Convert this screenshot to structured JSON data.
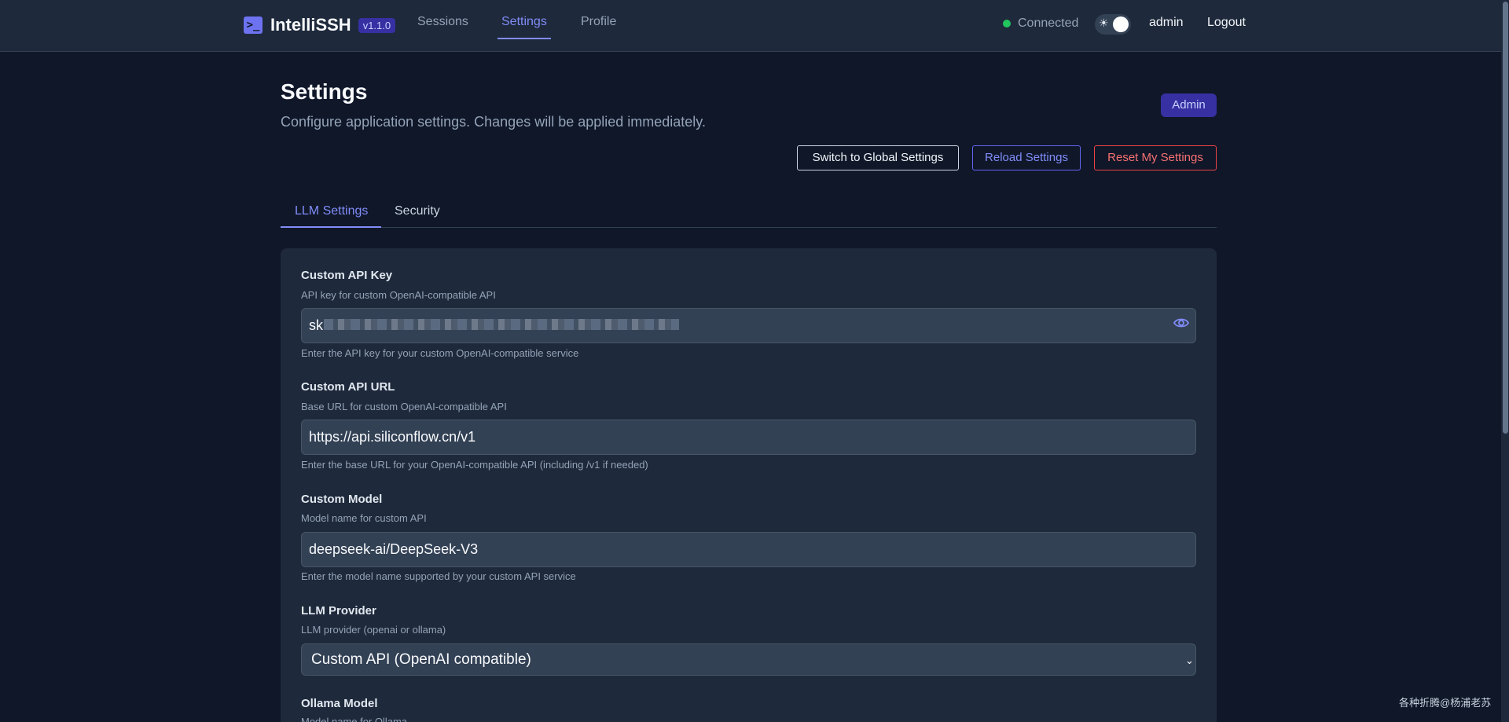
{
  "app": {
    "name": "IntelliSSH",
    "version": "v1.1.0"
  },
  "nav": {
    "sessions": "Sessions",
    "settings": "Settings",
    "profile": "Profile"
  },
  "header": {
    "status": "Connected",
    "theme_icon": "sun-icon",
    "user": "admin",
    "logout": "Logout"
  },
  "page": {
    "title": "Settings",
    "subtitle": "Configure application settings. Changes will be applied immediately.",
    "role_badge": "Admin",
    "actions": {
      "switch_global": "Switch to Global Settings",
      "reload": "Reload Settings",
      "reset": "Reset My Settings"
    }
  },
  "tabs": {
    "llm": "LLM Settings",
    "security": "Security"
  },
  "fields": [
    {
      "label": "Custom API Key",
      "description": "API key for custom OpenAI-compatible API",
      "value": "sk",
      "help": "Enter the API key for your custom OpenAI-compatible service"
    },
    {
      "label": "Custom API URL",
      "description": "Base URL for custom OpenAI-compatible API",
      "value": "https://api.siliconflow.cn/v1",
      "help": "Enter the base URL for your OpenAI-compatible API (including /v1 if needed)"
    },
    {
      "label": "Custom Model",
      "description": "Model name for custom API",
      "value": "deepseek-ai/DeepSeek-V3",
      "help": "Enter the model name supported by your custom API service"
    },
    {
      "label": "LLM Provider",
      "description": "LLM provider (openai or ollama)",
      "value": "Custom API (OpenAI compatible)"
    },
    {
      "label": "Ollama Model",
      "description": "Model name for Ollama"
    }
  ],
  "watermark": "各种折腾@杨浦老苏",
  "colors": {
    "background": "#0f1729",
    "panel": "#1e293b",
    "accent": "#818cf8",
    "danger": "#ef4444",
    "status_ok": "#22c55e"
  }
}
